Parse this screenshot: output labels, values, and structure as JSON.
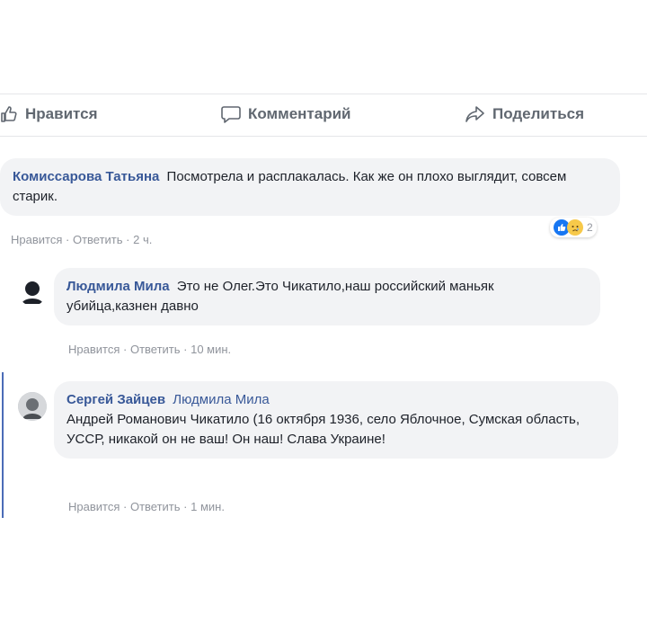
{
  "actions": {
    "like": "Нравится",
    "comment": "Комментарий",
    "share": "Поделиться"
  },
  "comments": [
    {
      "author": "Комиссарова Татьяна",
      "text": "Посмотрела и расплакалась. Как же он плохо выглядит, совсем старик.",
      "like": "Нравится",
      "reply": "Ответить",
      "time": "2 ч.",
      "reactions_count": "2",
      "reaction_icons": [
        "like-icon",
        "sad-icon"
      ]
    },
    {
      "author": "Людмила Мила",
      "text": "Это не Олег.Это Чикатило,наш российский маньяк убийца,казнен давно",
      "like": "Нравится",
      "reply": "Ответить",
      "time": "10 мин."
    },
    {
      "author": "Сергей Зайцев",
      "mention": "Людмила Мила",
      "text": "Андрей Романович Чикатило (16 октября 1936, село Яблочное, Сумская область, УССР, никакой он не ваш! Он наш! Слава Украине!",
      "like": "Нравится",
      "reply": "Ответить",
      "time": "1 мин."
    }
  ],
  "colors": {
    "author_link": "#385898",
    "bubble_bg": "#f2f3f5",
    "meta_text": "#90949c",
    "like_blue": "#1877f2"
  }
}
